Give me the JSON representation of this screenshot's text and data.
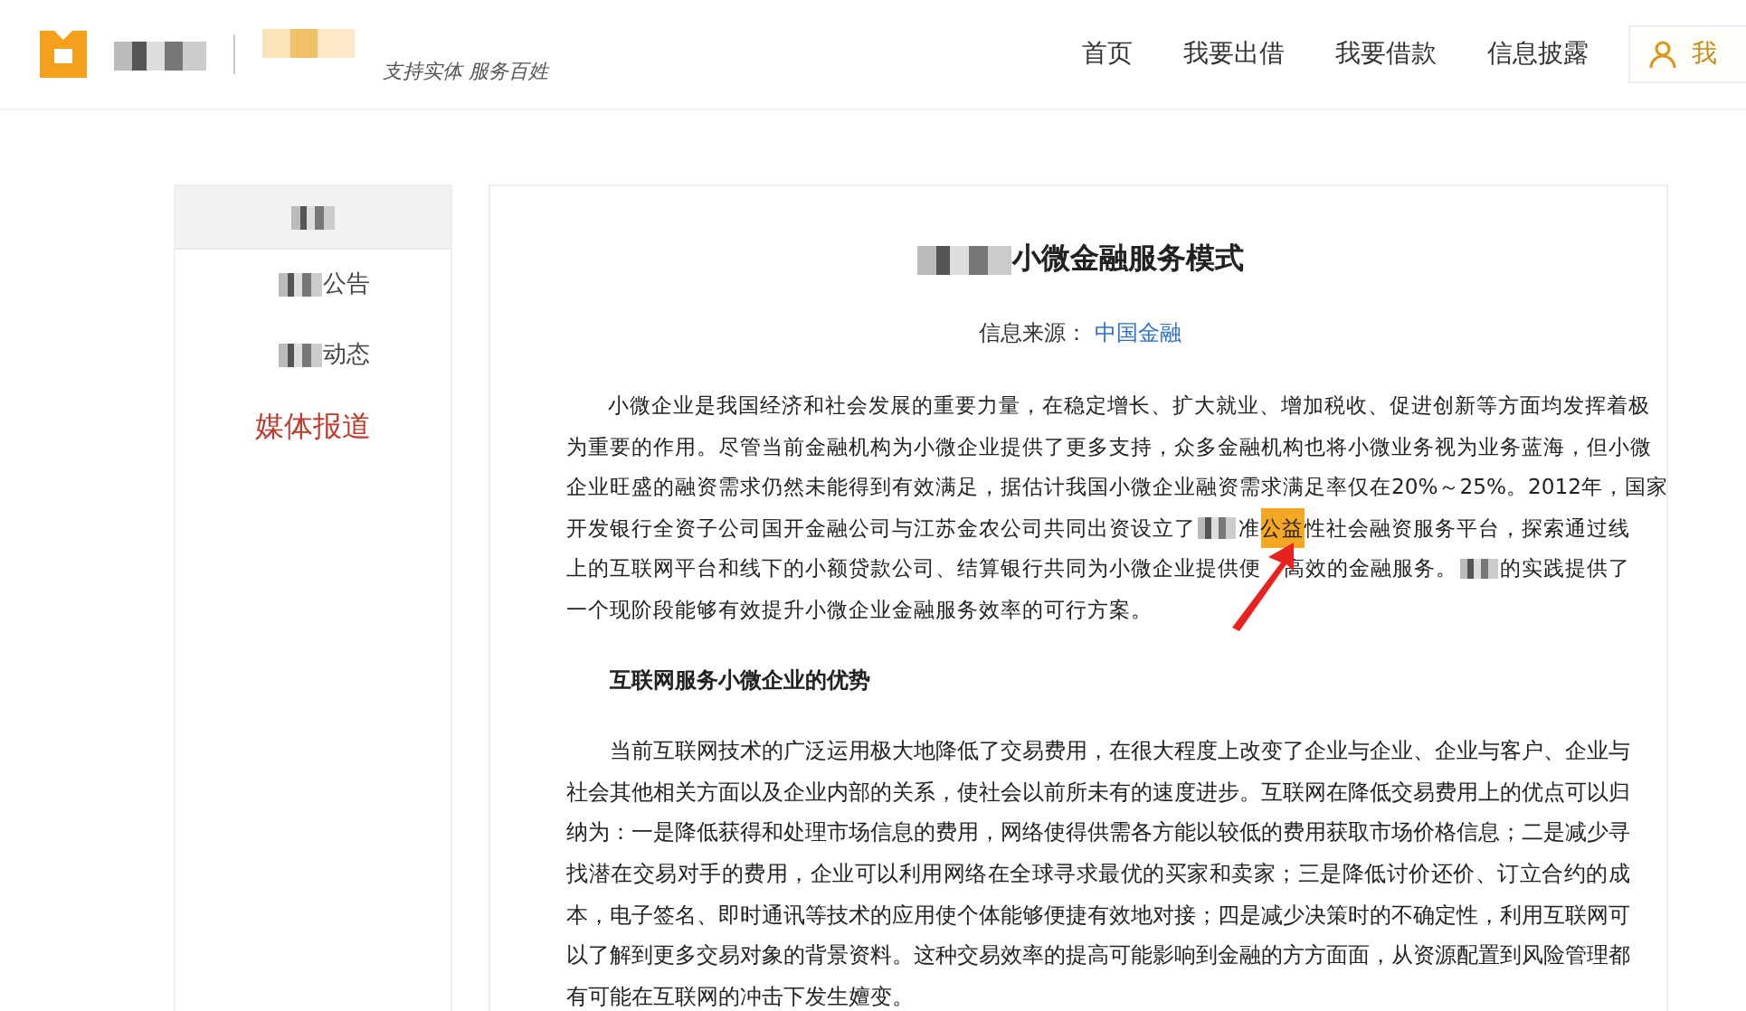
{
  "header": {
    "slogan": "支持实体 服务百姓",
    "nav": [
      "首页",
      "我要出借",
      "我要借款",
      "信息披露"
    ],
    "account_button": "我"
  },
  "sidebar": {
    "items": [
      {
        "kind": "header",
        "selected": false,
        "parts": [
          {
            "kind": "mosaic"
          }
        ]
      },
      {
        "kind": "item",
        "selected": false,
        "parts": [
          {
            "kind": "mosaic"
          },
          {
            "kind": "text",
            "text": "公告"
          }
        ]
      },
      {
        "kind": "item",
        "selected": false,
        "parts": [
          {
            "kind": "mosaic"
          },
          {
            "kind": "text",
            "text": "动态"
          }
        ]
      },
      {
        "kind": "item",
        "selected": true,
        "parts": [
          {
            "kind": "text",
            "text": "媒体报道"
          }
        ]
      }
    ]
  },
  "article": {
    "title": [
      {
        "kind": "mosaic"
      },
      {
        "kind": "text",
        "text": "小微金融服务模式"
      }
    ],
    "source_label": "信息来源：",
    "source": "中国金融",
    "paragraphs": [
      {
        "kind": "lines",
        "lines": [
          [
            {
              "kind": "text",
              "text": "小微企业是我国经济和社会发展的重要力量，在稳定增长、扩大就业、增加税收、促进创新等方面均发挥着极"
            }
          ],
          [
            {
              "kind": "text",
              "text": "为重要的作用。尽管当前金融机构为小微企业提供了更多支持，众多金融机构也将小微业务视为业务蓝海，但小微"
            }
          ],
          [
            {
              "kind": "text",
              "text": "企业旺盛的融资需求仍然未能得到有效满足，据估计我国小微企业融资需求满足率仅在20%～25%。2012年，国家"
            }
          ],
          [
            {
              "kind": "text",
              "text": "开发银行全资子公司国开金融公司与江苏金农公司共同出资设立了"
            },
            {
              "kind": "mosaic"
            },
            {
              "kind": "text",
              "text": "准"
            },
            {
              "kind": "highlight",
              "text": "公益"
            },
            {
              "kind": "text",
              "text": "性社会融资服务平台，探索通过线"
            }
          ],
          [
            {
              "kind": "text",
              "text": "上的互联网平台和线下的小额贷款公司、结算银行共同为小微企业提供便"
            },
            {
              "kind": "covered"
            },
            {
              "kind": "text",
              "text": "高效的金融服务。"
            },
            {
              "kind": "mosaic"
            },
            {
              "kind": "text",
              "text": "的实践提供了"
            }
          ],
          [
            {
              "kind": "text",
              "text": "一个现阶段能够有效提升小微企业金融服务效率的可行方案。"
            }
          ]
        ]
      },
      {
        "kind": "heading",
        "text": "互联网服务小微企业的优势"
      },
      {
        "kind": "body",
        "text": "当前互联网技术的广泛运用极大地降低了交易费用，在很大程度上改变了企业与企业、企业与客户、企业与社会其他相关方面以及企业内部的关系，使社会以前所未有的速度进步。互联网在降低交易费用上的优点可以归纳为：一是降低获得和处理市场信息的费用，网络使得供需各方能以较低的费用获取市场价格信息；二是减少寻找潜在交易对手的费用，企业可以利用网络在全球寻求最优的买家和卖家；三是降低讨价还价、订立合约的成本，电子签名、即时通讯等技术的应用使个体能够便捷有效地对接；四是减少决策时的不确定性，利用互联网可以了解到更多交易对象的背景资料。这种交易效率的提高可能影响到金融的方方面面，从资源配置到风险管理都有可能在互联网的冲击下发生嬗变。"
      }
    ]
  }
}
